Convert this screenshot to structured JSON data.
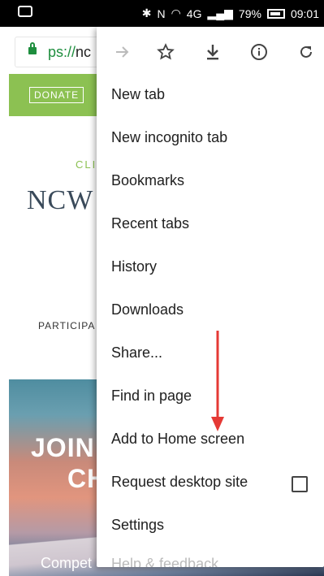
{
  "status_bar": {
    "battery_percent": "79%",
    "time": "09:01",
    "network": "4G"
  },
  "address_bar": {
    "scheme": "ps://",
    "rest": "nc"
  },
  "website": {
    "donate_label": "DONATE",
    "subtitle": "CLI",
    "title": "NCW",
    "nav_item": "PARTICIPA",
    "hero_line1": "JOIN A",
    "hero_line2": "CHA",
    "hero_bottom": "Compet"
  },
  "menu": {
    "icons": [
      "forward-icon",
      "star-icon",
      "download-icon",
      "info-icon",
      "reload-icon"
    ],
    "items": [
      {
        "label": "New tab"
      },
      {
        "label": "New incognito tab"
      },
      {
        "label": "Bookmarks"
      },
      {
        "label": "Recent tabs"
      },
      {
        "label": "History"
      },
      {
        "label": "Downloads"
      },
      {
        "label": "Share..."
      },
      {
        "label": "Find in page"
      },
      {
        "label": "Add to Home screen"
      },
      {
        "label": "Request desktop site"
      },
      {
        "label": "Settings"
      }
    ],
    "request_desktop_checked": false,
    "partial_item": "Help & feedback"
  },
  "colors": {
    "site_green": "#8cc152",
    "lock_green": "#1e8e3e",
    "annotation_arrow": "#e53935"
  }
}
